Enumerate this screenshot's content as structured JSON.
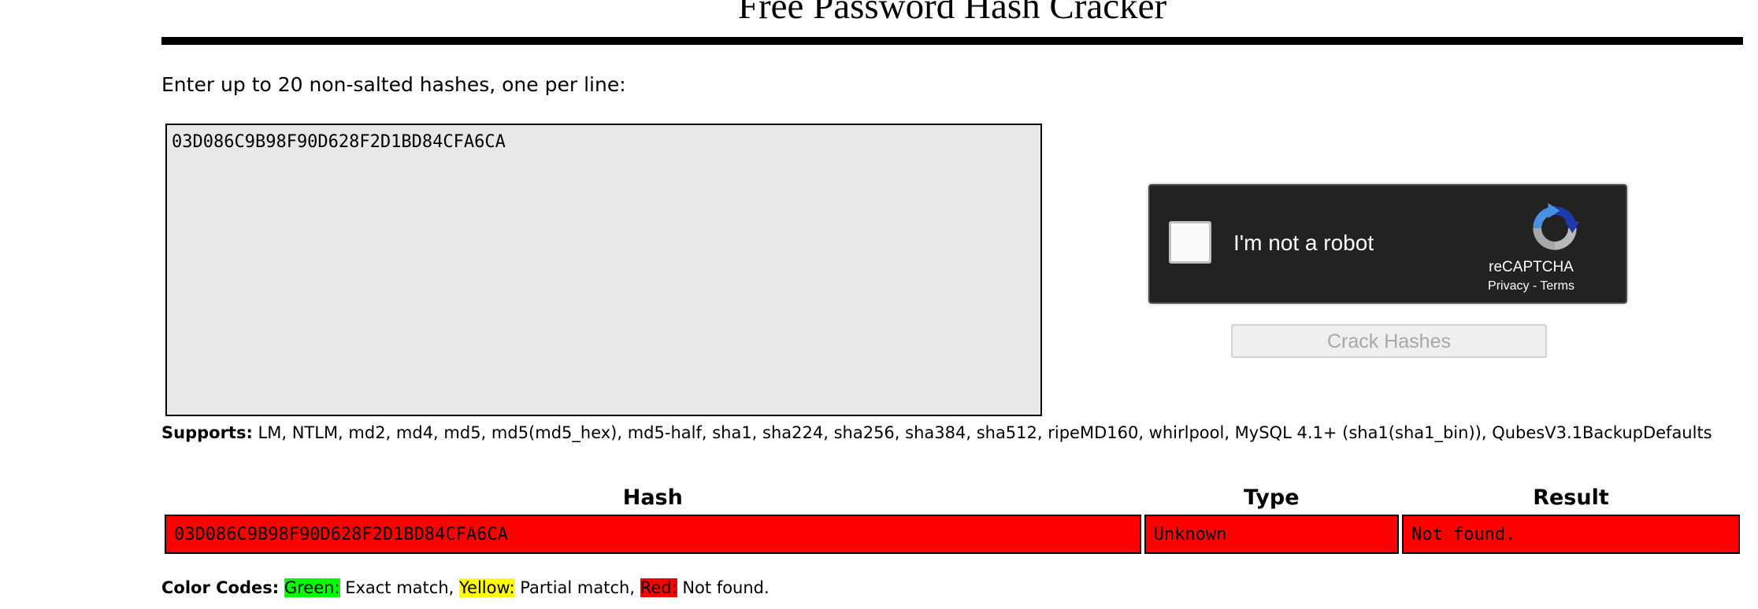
{
  "page": {
    "title": "Free Password Hash Cracker"
  },
  "form": {
    "instructions": "Enter up to 20 non-salted hashes, one per line:",
    "hash_input_value": "03D086C9B98F90D628F2D1BD84CFA6CA",
    "crack_button_label": "Crack Hashes"
  },
  "recaptcha": {
    "label": "I'm not a robot",
    "brand": "reCAPTCHA",
    "privacy_label": "Privacy",
    "separator": " - ",
    "terms_label": "Terms",
    "icon": "recaptcha-logo-icon",
    "checked": false
  },
  "supports": {
    "label": "Supports:",
    "text": " LM, NTLM, md2, md4, md5, md5(md5_hex), md5-half, sha1, sha224, sha256, sha384, sha512, ripeMD160, whirlpool, MySQL 4.1+ (sha1(sha1_bin)), QubesV3.1BackupDefaults"
  },
  "results": {
    "headers": {
      "hash": "Hash",
      "type": "Type",
      "result": "Result"
    },
    "rows": [
      {
        "hash": "03D086C9B98F90D628F2D1BD84CFA6CA",
        "type": "Unknown",
        "result": "Not found.",
        "status_color": "#ff0000"
      }
    ]
  },
  "color_codes": {
    "label": "Color Codes:",
    "green_label": "Green:",
    "green_text": " Exact match, ",
    "yellow_label": "Yellow:",
    "yellow_text": " Partial match, ",
    "red_label": "Red:",
    "red_text": " Not found.",
    "colors": {
      "green": "#00ff00",
      "yellow": "#ffff00",
      "red": "#ff0000"
    }
  }
}
